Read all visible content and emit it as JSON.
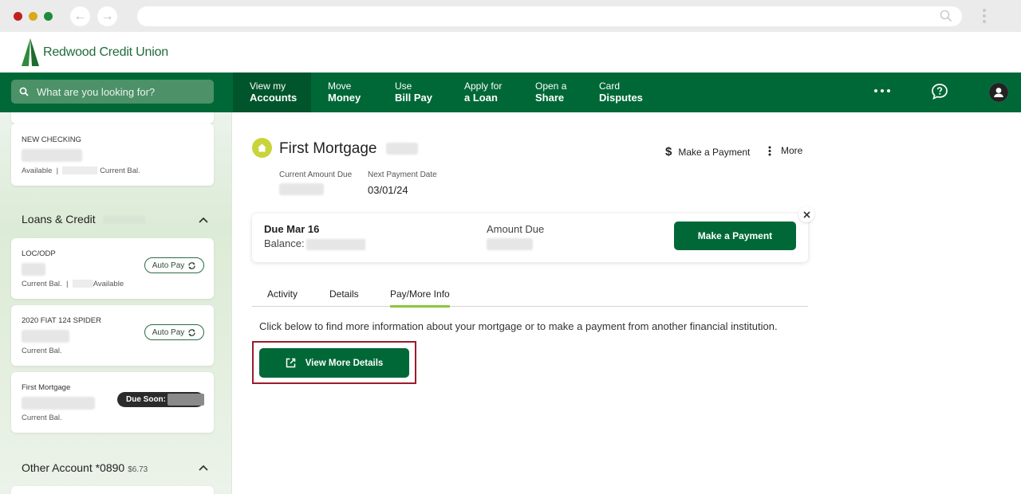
{
  "header": {
    "logo_text": "Redwood Credit Union"
  },
  "search": {
    "placeholder": "What are you looking for?"
  },
  "nav": [
    {
      "line1": "View my",
      "line2": "Accounts"
    },
    {
      "line1": "Move",
      "line2": "Money"
    },
    {
      "line1": "Use",
      "line2": "Bill Pay"
    },
    {
      "line1": "Apply for",
      "line2": "a Loan"
    },
    {
      "line1": "Open a",
      "line2": "Share"
    },
    {
      "line1": "Card",
      "line2": "Disputes"
    }
  ],
  "sidebar": {
    "checking": {
      "name": "NEW CHECKING",
      "available": "Available",
      "separator": "|",
      "current": "Current Bal."
    },
    "loans_section": {
      "title": "Loans & Credit"
    },
    "loans": [
      {
        "name": "LOC/ODP",
        "badge": "Auto Pay",
        "foot_a": "Current Bal.",
        "separator": "|",
        "foot_b": "Available"
      },
      {
        "name": "2020 FIAT 124 SPIDER",
        "badge": "Auto Pay",
        "foot_a": "Current Bal."
      },
      {
        "name": "First Mortgage",
        "badge": "Due Soon:",
        "foot_a": "Current Bal."
      }
    ],
    "other_section": {
      "title": "Other Account *0890",
      "amount": "$6.73"
    }
  },
  "main": {
    "title": "First Mortgage",
    "actions": {
      "pay": "Make a Payment",
      "more": "More"
    },
    "meta": {
      "current_due_label": "Current Amount Due",
      "next_date_label": "Next Payment Date",
      "next_date_value": "03/01/24"
    },
    "due_card": {
      "title": "Due Mar 16",
      "balance_label": "Balance:",
      "amount_label": "Amount Due",
      "button": "Make a Payment"
    },
    "tabs": [
      "Activity",
      "Details",
      "Pay/More Info"
    ],
    "info_text": "Click below to find more information about your mortgage or to make a payment from another financial institution.",
    "view_button": "View More Details"
  },
  "colors": {
    "brand_green": "#006837",
    "accent_lime": "#8dc63f",
    "highlight_red": "#9c1c2a"
  }
}
